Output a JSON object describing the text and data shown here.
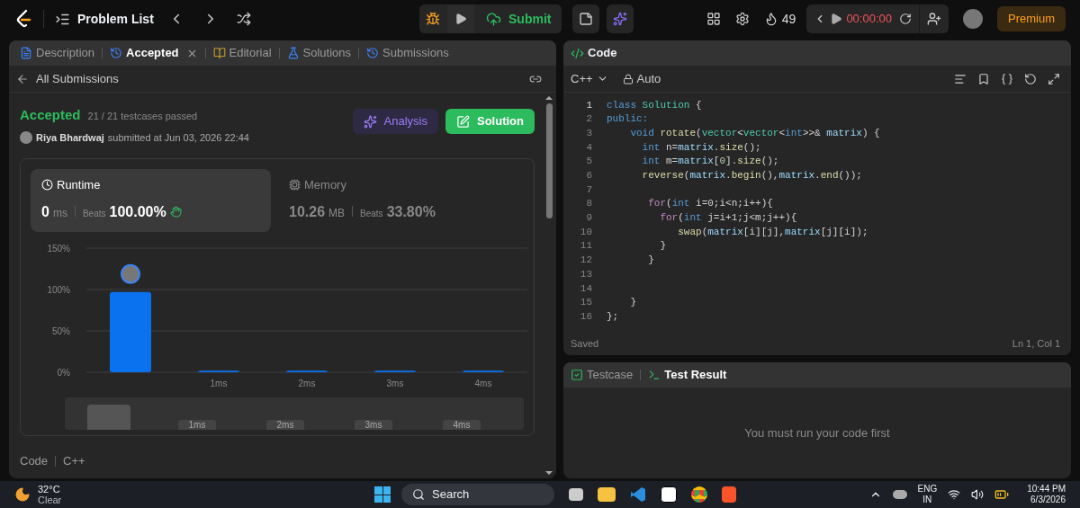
{
  "topbar": {
    "title": "Problem List",
    "submit": "Submit",
    "streak": "49",
    "timer": "00:00:00",
    "premium": "Premium"
  },
  "left_tabs": [
    {
      "label": "Description",
      "selected": false,
      "closable": false
    },
    {
      "label": "Accepted",
      "selected": true,
      "closable": true
    },
    {
      "label": "Editorial",
      "selected": false,
      "closable": false
    },
    {
      "label": "Solutions",
      "selected": false,
      "closable": false
    },
    {
      "label": "Submissions",
      "selected": false,
      "closable": false
    }
  ],
  "back_link": "All Submissions",
  "submission": {
    "status": "Accepted",
    "passed": "21 / 21 testcases passed",
    "user": "Riya Bhardwaj",
    "submitted": "submitted at Jun 03, 2026 22:44",
    "analysis": "Analysis",
    "solution": "Solution"
  },
  "stats": [
    {
      "title": "Runtime",
      "value": "0",
      "unit": "ms",
      "beats_label": "Beats",
      "beats": "100.00%",
      "selected": true
    },
    {
      "title": "Memory",
      "value": "10.26",
      "unit": "MB",
      "beats_label": "Beats",
      "beats": "33.80%",
      "selected": false
    }
  ],
  "chart_data": {
    "type": "bar",
    "categories": [
      null,
      "1ms",
      "2ms",
      "3ms",
      "4ms"
    ],
    "values": [
      97,
      2,
      2,
      2,
      2
    ],
    "ylim": [
      0,
      150
    ],
    "yticks": [
      {
        "value": 0,
        "label": "0%"
      },
      {
        "value": 50,
        "label": "50%"
      },
      {
        "value": 100,
        "label": "100%"
      },
      {
        "value": 150,
        "label": "150%"
      }
    ]
  },
  "overview_labels": [
    "1ms",
    "2ms",
    "3ms",
    "4ms"
  ],
  "code_header": {
    "label": "Code",
    "language": "C++"
  },
  "editor": {
    "title": "Code",
    "language": "C++",
    "mode": "Auto",
    "status": "Saved",
    "cursor": "Ln 1, Col 1",
    "lines": [
      {
        "number": "1",
        "tokens": [
          {
            "text": "class",
            "kind": "kw"
          },
          {
            "text": " Solution",
            "kind": "type"
          },
          {
            "text": " {",
            "kind": "plain"
          }
        ]
      },
      {
        "number": "2",
        "tokens": [
          {
            "text": "public:",
            "kind": "kw"
          }
        ]
      },
      {
        "number": "3",
        "tokens": [
          {
            "text": "    void",
            "kind": "kw"
          },
          {
            "text": " rotate",
            "kind": "fn"
          },
          {
            "text": "(",
            "kind": "plain"
          },
          {
            "text": "vector",
            "kind": "type"
          },
          {
            "text": "<",
            "kind": "plain"
          },
          {
            "text": "vector",
            "kind": "type"
          },
          {
            "text": "<",
            "kind": "plain"
          },
          {
            "text": "int",
            "kind": "kw"
          },
          {
            "text": ">>& ",
            "kind": "plain"
          },
          {
            "text": "matrix",
            "kind": "var"
          },
          {
            "text": ") {",
            "kind": "plain"
          }
        ]
      },
      {
        "number": "4",
        "tokens": [
          {
            "text": "      int",
            "kind": "kw"
          },
          {
            "text": " n=",
            "kind": "plain"
          },
          {
            "text": "matrix",
            "kind": "var"
          },
          {
            "text": ".",
            "kind": "plain"
          },
          {
            "text": "size",
            "kind": "fn"
          },
          {
            "text": "();",
            "kind": "plain"
          }
        ]
      },
      {
        "number": "5",
        "tokens": [
          {
            "text": "      int",
            "kind": "kw"
          },
          {
            "text": " m=",
            "kind": "plain"
          },
          {
            "text": "matrix",
            "kind": "var"
          },
          {
            "text": "[",
            "kind": "plain"
          },
          {
            "text": "0",
            "kind": "num"
          },
          {
            "text": "].",
            "kind": "plain"
          },
          {
            "text": "size",
            "kind": "fn"
          },
          {
            "text": "();",
            "kind": "plain"
          }
        ]
      },
      {
        "number": "6",
        "tokens": [
          {
            "text": "      reverse",
            "kind": "fn"
          },
          {
            "text": "(",
            "kind": "plain"
          },
          {
            "text": "matrix",
            "kind": "var"
          },
          {
            "text": ".",
            "kind": "plain"
          },
          {
            "text": "begin",
            "kind": "fn"
          },
          {
            "text": "(),",
            "kind": "plain"
          },
          {
            "text": "matrix",
            "kind": "var"
          },
          {
            "text": ".",
            "kind": "plain"
          },
          {
            "text": "end",
            "kind": "fn"
          },
          {
            "text": "());",
            "kind": "plain"
          }
        ]
      },
      {
        "number": "7"
      },
      {
        "number": "8",
        "tokens": [
          {
            "text": "       for",
            "kind": "ctrl"
          },
          {
            "text": "(",
            "kind": "plain"
          },
          {
            "text": "int",
            "kind": "kw"
          },
          {
            "text": " i=0;i<n;i++){",
            "kind": "plain"
          }
        ]
      },
      {
        "number": "9",
        "tokens": [
          {
            "text": "         for",
            "kind": "ctrl"
          },
          {
            "text": "(",
            "kind": "plain"
          },
          {
            "text": "int",
            "kind": "kw"
          },
          {
            "text": " j=i+1;j<m;j++){",
            "kind": "plain"
          }
        ]
      },
      {
        "number": "10",
        "tokens": [
          {
            "text": "            swap",
            "kind": "fn"
          },
          {
            "text": "(",
            "kind": "plain"
          },
          {
            "text": "matrix",
            "kind": "var"
          },
          {
            "text": "[i][j],",
            "kind": "plain"
          },
          {
            "text": "matrix",
            "kind": "var"
          },
          {
            "text": "[j][i]);",
            "kind": "plain"
          }
        ]
      },
      {
        "number": "11",
        "tokens": [
          {
            "text": "         }",
            "kind": "plain"
          }
        ]
      },
      {
        "number": "12",
        "tokens": [
          {
            "text": "       }",
            "kind": "plain"
          }
        ]
      },
      {
        "number": "13"
      },
      {
        "number": "14"
      },
      {
        "number": "15",
        "tokens": [
          {
            "text": "    }",
            "kind": "plain"
          }
        ]
      },
      {
        "number": "16",
        "tokens": [
          {
            "text": "};",
            "kind": "plain"
          }
        ]
      }
    ]
  },
  "test_tabs": [
    {
      "label": "Testcase",
      "selected": false
    },
    {
      "label": "Test Result",
      "selected": true
    }
  ],
  "test_message": "You must run your code first",
  "taskbar": {
    "temp": "32°C",
    "weather": "Clear",
    "search": "Search",
    "lang": "ENG",
    "region": "IN",
    "time": "10:44 PM",
    "date": "6/3/2026"
  }
}
